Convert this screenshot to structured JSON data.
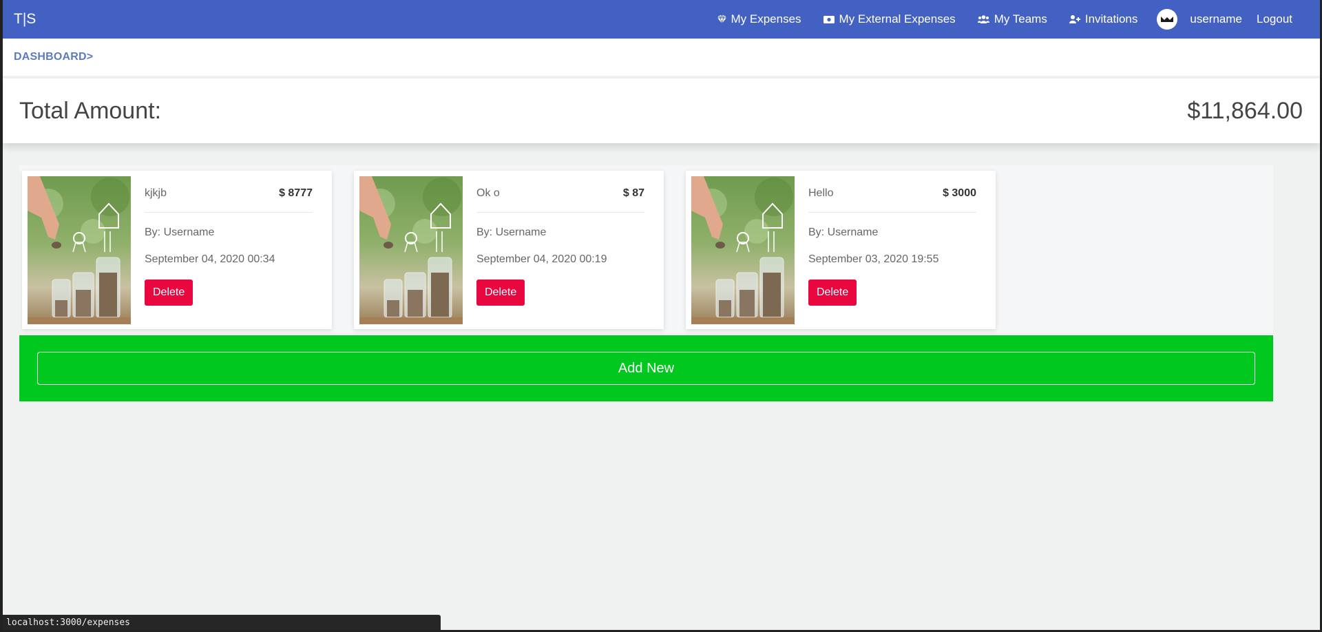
{
  "navbar": {
    "brand": "T|S",
    "items": [
      {
        "label": "My Expenses",
        "icon": "gem-icon"
      },
      {
        "label": "My External Expenses",
        "icon": "money-bill-icon"
      },
      {
        "label": "My Teams",
        "icon": "users-icon"
      },
      {
        "label": "Invitations",
        "icon": "user-plus-icon"
      }
    ],
    "username": "username",
    "logout": "Logout"
  },
  "breadcrumb": "DASHBOARD>",
  "total": {
    "label": "Total Amount:",
    "value": "$11,864.00"
  },
  "expenses": [
    {
      "title": "kjkjb",
      "amount": "$ 8777",
      "by": "By: Username",
      "date": "September 04, 2020 00:34",
      "delete_label": "Delete"
    },
    {
      "title": "Ok o",
      "amount": "$ 87",
      "by": "By: Username",
      "date": "September 04, 2020 00:19",
      "delete_label": "Delete"
    },
    {
      "title": "Hello",
      "amount": "$ 3000",
      "by": "By: Username",
      "date": "September 03, 2020 19:55",
      "delete_label": "Delete"
    }
  ],
  "add_new_label": "Add New",
  "status_url": "localhost:3000/expenses",
  "colors": {
    "navbar": "#4361c2",
    "delete": "#e8073f",
    "add_panel": "#00c81e"
  }
}
